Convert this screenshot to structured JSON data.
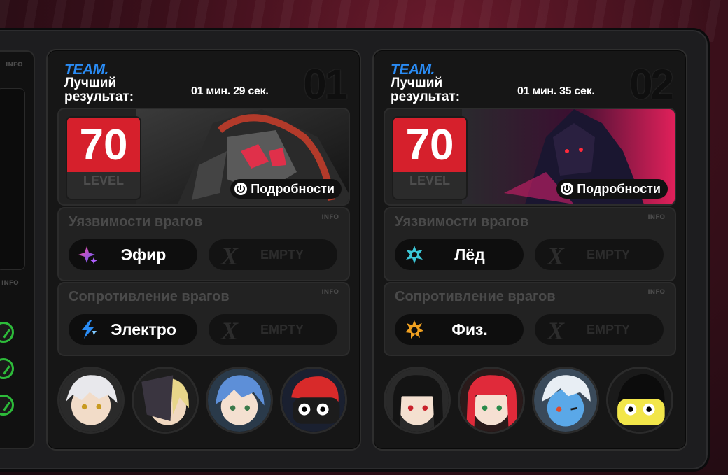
{
  "left_panel": {
    "info_top": "INFO",
    "info_mid": "INFO"
  },
  "teams": [
    {
      "team_label": "TEAM.",
      "best_label": "Лучший результат:",
      "time": "01 мин.  29 сек.",
      "number": "01",
      "level": "70",
      "level_label": "LEVEL",
      "details_label": "Подробности",
      "weakness": {
        "title": "Уязвимости врагов",
        "info": "INFO",
        "element": "Эфир",
        "element_icon": "ether-star-icon",
        "empty_label": "EMPTY"
      },
      "resistance": {
        "title": "Сопротивление врагов",
        "info": "INFO",
        "element": "Электро",
        "element_icon": "electric-bolt-icon",
        "empty_label": "EMPTY"
      },
      "avatars": [
        "agent-white-hair",
        "agent-masked-blonde",
        "agent-blue-hair",
        "agent-bangboo-red"
      ]
    },
    {
      "team_label": "TEAM.",
      "best_label": "Лучший результат:",
      "time": "01 мин.  35 сек.",
      "number": "02",
      "level": "70",
      "level_label": "LEVEL",
      "details_label": "Подробности",
      "weakness": {
        "title": "Уязвимости врагов",
        "info": "INFO",
        "element": "Лёд",
        "element_icon": "ice-snowflake-icon",
        "empty_label": "EMPTY"
      },
      "resistance": {
        "title": "Сопротивление врагов",
        "info": "INFO",
        "element": "Физ.",
        "element_icon": "physical-burst-icon",
        "empty_label": "EMPTY"
      },
      "avatars": [
        "agent-black-hair",
        "agent-red-hair",
        "agent-blue-shark",
        "agent-bangboo-yellow"
      ]
    }
  ],
  "colors": {
    "accent_blue": "#2a8cf5",
    "level_red": "#d6202c",
    "panel": "#161616"
  }
}
